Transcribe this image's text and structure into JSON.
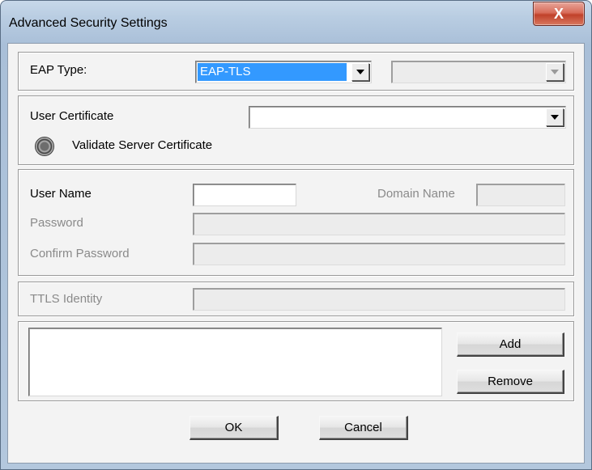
{
  "window": {
    "title": "Advanced Security Settings",
    "close_glyph": "X"
  },
  "eap": {
    "label": "EAP Type:",
    "selected": "EAP-TLS",
    "secondary_value": ""
  },
  "certificate": {
    "label": "User Certificate",
    "selected": "",
    "validate_label": "Validate Server Certificate"
  },
  "credentials": {
    "user_name_label": "User Name",
    "user_name_value": "",
    "domain_name_label": "Domain Name",
    "domain_name_value": "",
    "password_label": "Password",
    "password_value": "",
    "confirm_password_label": "Confirm Password",
    "confirm_password_value": ""
  },
  "ttls": {
    "label": "TTLS Identity",
    "value": ""
  },
  "list": {
    "items": [],
    "add_label": "Add",
    "remove_label": "Remove"
  },
  "footer": {
    "ok_label": "OK",
    "cancel_label": "Cancel"
  },
  "colors": {
    "selection": "#3399ff",
    "close_button": "#c0412a",
    "disabled_text": "#8a8a8a"
  }
}
